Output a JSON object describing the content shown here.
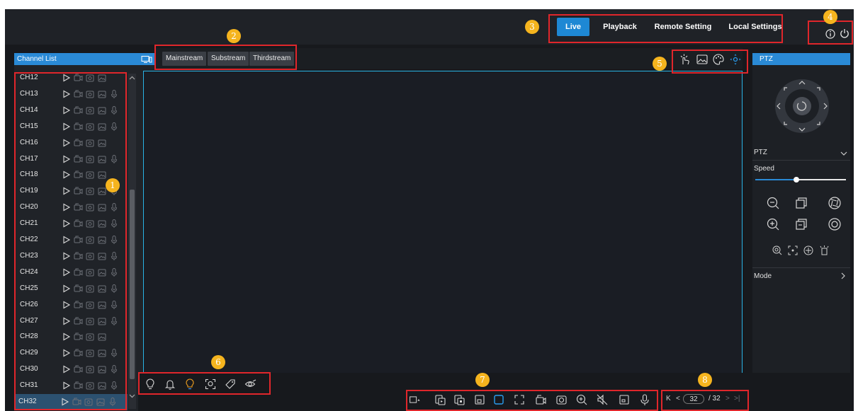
{
  "nav": {
    "tabs": [
      {
        "label": "Live",
        "active": true
      },
      {
        "label": "Playback",
        "active": false
      },
      {
        "label": "Remote Setting",
        "active": false
      },
      {
        "label": "Local Settings",
        "active": false
      }
    ],
    "right_icons": [
      "info-icon",
      "power-icon"
    ]
  },
  "channel_list": {
    "title": "Channel List",
    "header_icon": "channel-switch-icon",
    "channels": [
      {
        "name": "CH12",
        "mic": false
      },
      {
        "name": "CH13",
        "mic": true
      },
      {
        "name": "CH14",
        "mic": true
      },
      {
        "name": "CH15",
        "mic": true
      },
      {
        "name": "CH16",
        "mic": false
      },
      {
        "name": "CH17",
        "mic": true
      },
      {
        "name": "CH18",
        "mic": false
      },
      {
        "name": "CH19",
        "mic": true
      },
      {
        "name": "CH20",
        "mic": true
      },
      {
        "name": "CH21",
        "mic": true
      },
      {
        "name": "CH22",
        "mic": true
      },
      {
        "name": "CH23",
        "mic": true
      },
      {
        "name": "CH24",
        "mic": true
      },
      {
        "name": "CH25",
        "mic": true
      },
      {
        "name": "CH26",
        "mic": true
      },
      {
        "name": "CH27",
        "mic": true
      },
      {
        "name": "CH28",
        "mic": false
      },
      {
        "name": "CH29",
        "mic": true
      },
      {
        "name": "CH30",
        "mic": true
      },
      {
        "name": "CH31",
        "mic": true
      },
      {
        "name": "CH32",
        "mic": true,
        "selected": true
      }
    ]
  },
  "streams": {
    "mainstream": "Mainstream",
    "substream": "Substream",
    "thirdstream": "Thirdstream"
  },
  "view_tools": [
    "gesture-icon",
    "image-icon",
    "palette-icon",
    "ptz-direction-icon"
  ],
  "ptz": {
    "header": "PTZ",
    "section_label": "PTZ",
    "speed_label": "Speed",
    "speed_value": 0.45,
    "mode_label": "Mode"
  },
  "alarm_tools": [
    "light-icon",
    "bell-icon",
    "bulb-alert-icon",
    "face-detect-icon",
    "tag-icon",
    "view-icon"
  ],
  "toolbar_icons": [
    "layout-icon",
    "record-all-icon",
    "stop-all-icon",
    "window-icon",
    "original-ratio-icon",
    "fullscreen-icon",
    "record-icon",
    "snapshot-icon",
    "zoom-icon",
    "mute-icon",
    "screen-icon",
    "microphone-icon"
  ],
  "pagination": {
    "current": "32",
    "total": "/ 32",
    "first_symbol": "K",
    "prev_symbol": "<",
    "next_symbol": ">",
    "last_symbol": ">|"
  },
  "badges": [
    "1",
    "2",
    "3",
    "4",
    "5",
    "6",
    "7",
    "8"
  ],
  "colors": {
    "accent": "#2a8ad6",
    "highlight_box": "#e0262b",
    "badge": "#f5b41e",
    "view_border": "#29b4e5"
  }
}
